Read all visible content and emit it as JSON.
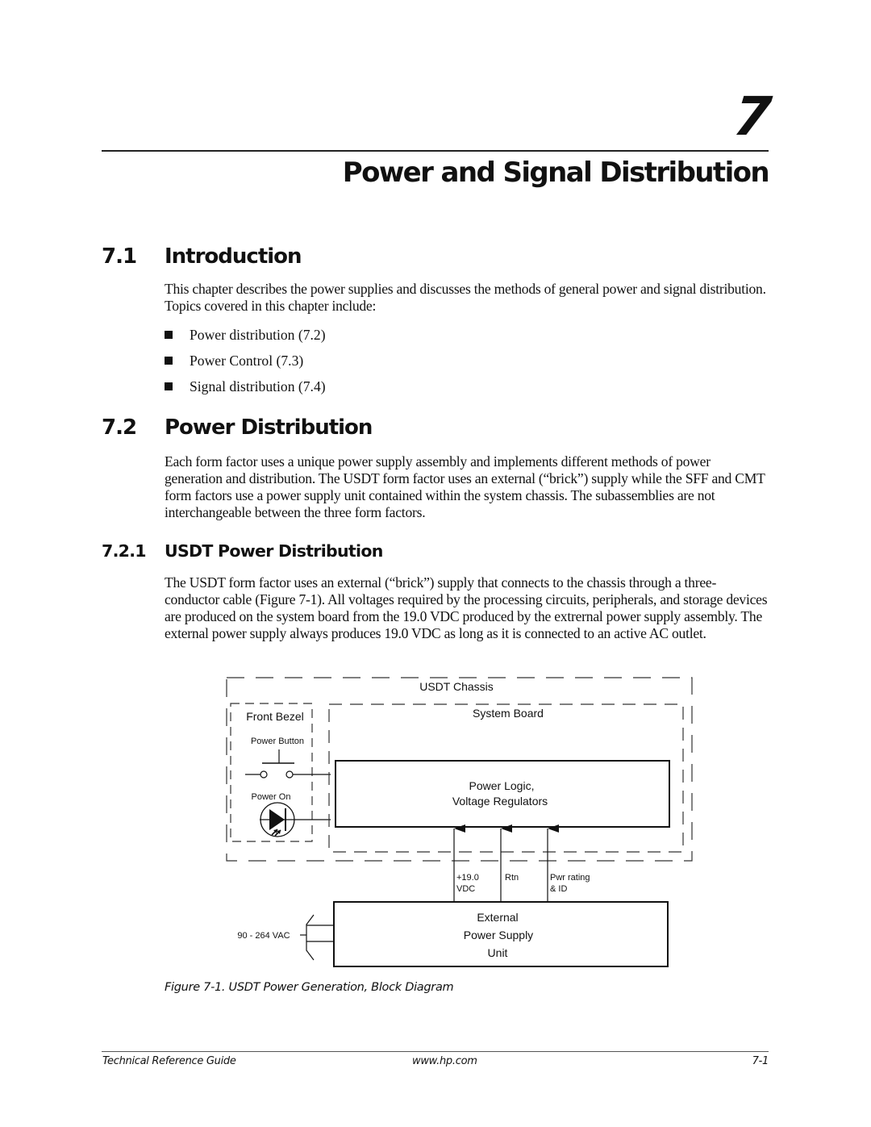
{
  "chapter": {
    "number": "7",
    "title": "Power and Signal Distribution"
  },
  "sections": [
    {
      "number": "7.1",
      "title": "Introduction",
      "paragraph": "This chapter describes the power supplies and discusses the methods of general power and signal distribution. Topics covered in this chapter include:",
      "bullets": [
        "Power distribution (7.2)",
        "Power Control (7.3)",
        "Signal distribution (7.4)"
      ]
    },
    {
      "number": "7.2",
      "title": "Power Distribution",
      "paragraph": "Each form factor uses a unique power supply assembly and implements different methods of power generation and distribution. The USDT form factor uses an external (“brick”) supply while the SFF and CMT form factors use a power supply unit contained within the system chassis. The subassemblies are not interchangeable between the three form factors."
    },
    {
      "number": "7.2.1",
      "title": "USDT Power Distribution",
      "paragraph": "The USDT form factor uses an external (“brick”) supply that connects to the chassis through a three-conductor cable (Figure 7-1). All voltages required by the processing circuits, peripherals, and storage devices are produced on the system board from the 19.0 VDC produced by the extrernal power supply assembly. The external power supply always produces 19.0 VDC as long as it is connected to an active AC outlet."
    }
  ],
  "figure": {
    "chassis_label": "USDT Chassis",
    "front_bezel_label": "Front Bezel",
    "power_button_label": "Power Button",
    "power_on_label": "Power On",
    "system_board_label": "System Board",
    "power_logic_lines": [
      "Power Logic,",
      "Voltage Regulators"
    ],
    "connectors": [
      {
        "lines": [
          "+19.0",
          "VDC"
        ]
      },
      {
        "lines": [
          "Rtn"
        ]
      },
      {
        "lines": [
          "Pwr rating",
          "& ID"
        ]
      }
    ],
    "ac_input_label": "90 - 264 VAC",
    "external_psu_lines": [
      "External",
      "Power Supply",
      "Unit"
    ],
    "caption": "Figure 7-1. USDT Power Generation, Block Diagram"
  },
  "footer": {
    "left": "Technical Reference Guide",
    "center": "www.hp.com",
    "right": "7-1"
  }
}
